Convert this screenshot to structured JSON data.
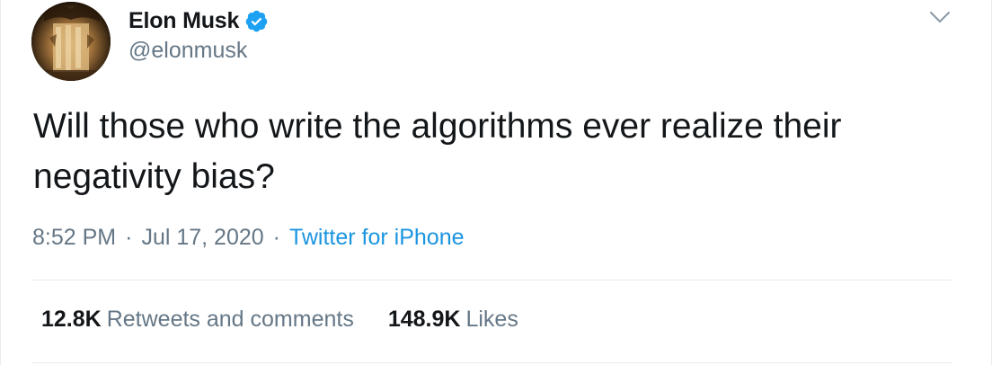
{
  "tweet": {
    "author": {
      "display_name": "Elon Musk",
      "handle": "@elonmusk",
      "verified": true,
      "avatar_icon": "avatar-image"
    },
    "menu_icon": "chevron-down-icon",
    "text": "Will those who write the algorithms ever realize their negativity bias?",
    "meta": {
      "time": "8:52 PM",
      "separator": "·",
      "date": "Jul 17, 2020",
      "source": "Twitter for iPhone"
    },
    "stats": {
      "retweets_count": "12.8K",
      "retweets_label": "Retweets and comments",
      "likes_count": "148.9K",
      "likes_label": "Likes"
    },
    "colors": {
      "text": "#14171a",
      "secondary": "#657786",
      "link": "#1b95e0",
      "verified": "#1da1f2",
      "divider": "#e6ecf0"
    }
  }
}
